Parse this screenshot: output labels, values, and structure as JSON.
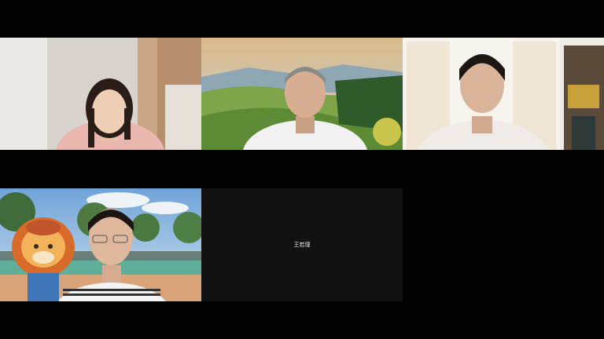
{
  "participants": [
    {
      "id": "p1",
      "video_on": true,
      "background": "room"
    },
    {
      "id": "p2",
      "video_on": true,
      "background": "virtual-landscape"
    },
    {
      "id": "p3",
      "video_on": true,
      "background": "room"
    },
    {
      "id": "p4",
      "video_on": true,
      "background": "virtual-park-with-mascot"
    },
    {
      "id": "p5",
      "video_on": false,
      "display_name": "王若瑾"
    }
  ],
  "colors": {
    "stage_bg": "#000000",
    "tile_off_bg": "#111111",
    "name_text": "#e6e6e6"
  }
}
